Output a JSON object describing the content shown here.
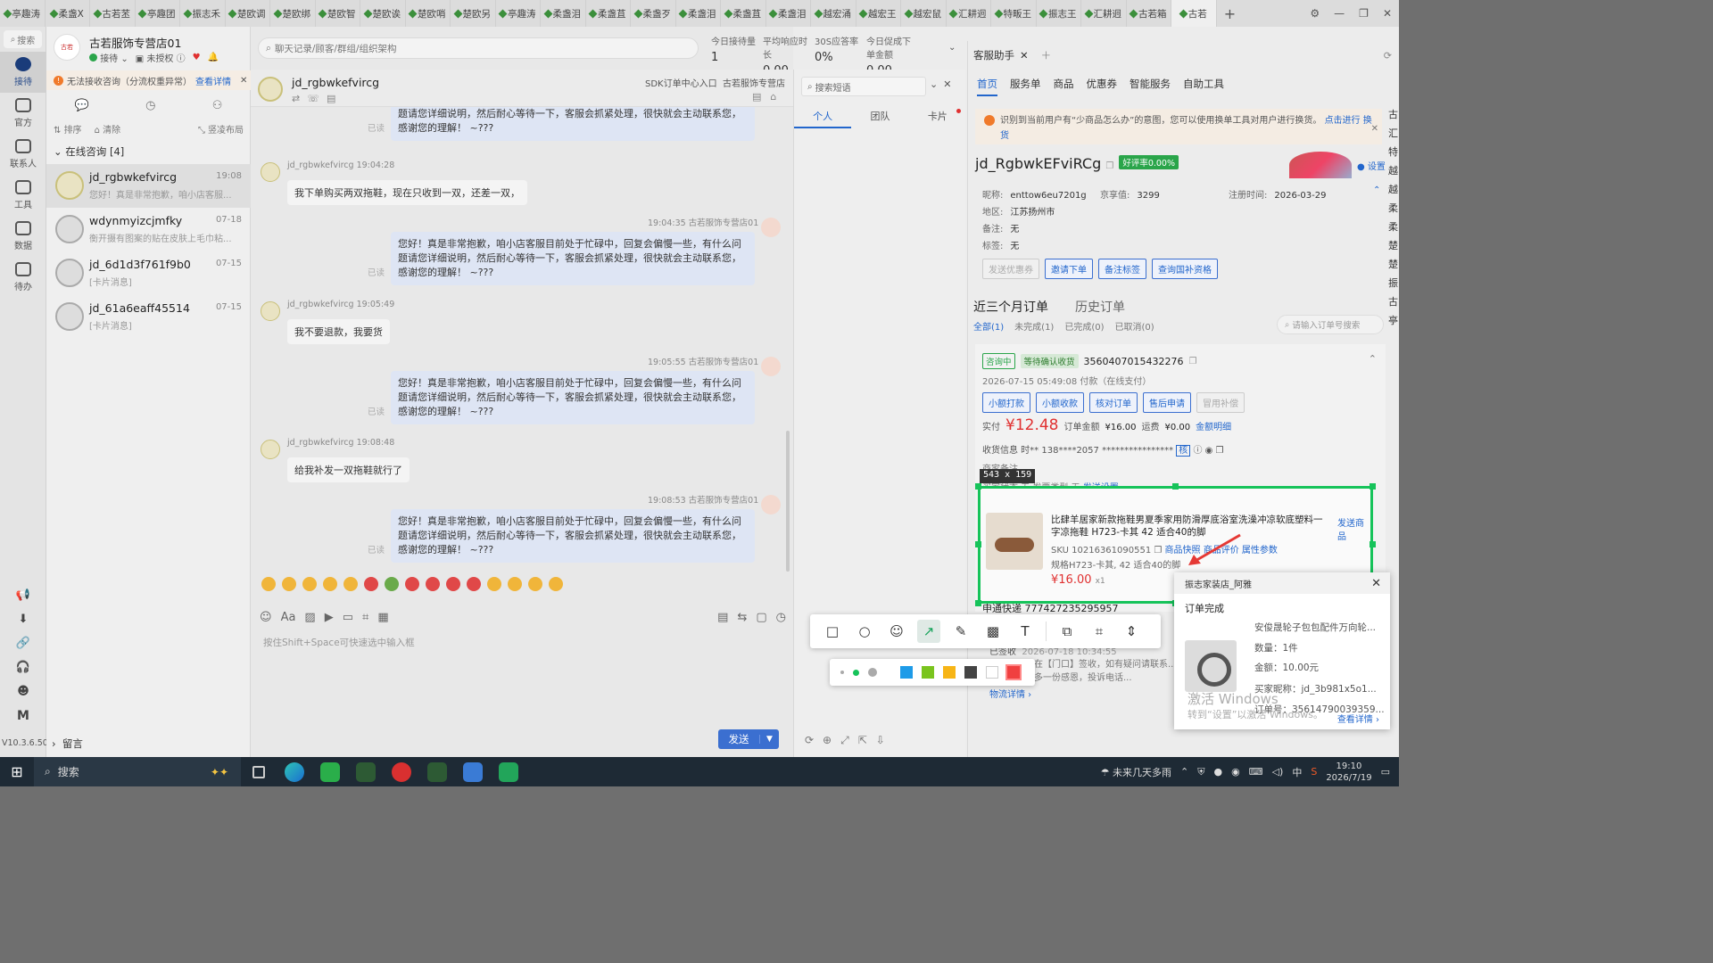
{
  "tabs": [
    {
      "label": "亭趣涛"
    },
    {
      "label": "柔盏X"
    },
    {
      "label": "古若苤"
    },
    {
      "label": "亭趣团"
    },
    {
      "label": "振志禾"
    },
    {
      "label": "楚欧调"
    },
    {
      "label": "楚欧绑"
    },
    {
      "label": "楚欧智"
    },
    {
      "label": "楚欧诶"
    },
    {
      "label": "楚欧哨"
    },
    {
      "label": "楚欧另"
    },
    {
      "label": "亭趣涛"
    },
    {
      "label": "柔盏泪"
    },
    {
      "label": "柔盏苴"
    },
    {
      "label": "柔盏歹"
    },
    {
      "label": "柔盏泪"
    },
    {
      "label": "柔盏苴"
    },
    {
      "label": "柔盏泪"
    },
    {
      "label": "越宏涌"
    },
    {
      "label": "越宏王"
    },
    {
      "label": "越宏鼠"
    },
    {
      "label": "汇耕迥"
    },
    {
      "label": "特畈王"
    },
    {
      "label": "振志王"
    },
    {
      "label": "汇耕迥"
    },
    {
      "label": "古若箱"
    },
    {
      "label": "古若"
    }
  ],
  "nav": {
    "search": "搜索",
    "items": [
      {
        "label": "接待"
      },
      {
        "label": "官方"
      },
      {
        "label": "联系人"
      },
      {
        "label": "工具"
      },
      {
        "label": "数据"
      },
      {
        "label": "待办"
      }
    ],
    "version": "V10.3.6.500",
    "m_label": "M"
  },
  "sessions_pane": {
    "shop_name": "古若服饰专营店01",
    "status_receiving": "接待",
    "status_unauth": "未授权",
    "warning": "无法接收咨询（分流权重异常）",
    "warning_link": "查看详情",
    "tools": {
      "sort": "排序",
      "clear": "清除",
      "layout": "竖凌布局"
    },
    "online_header": "在线咨询 [4]",
    "items": [
      {
        "name": "jd_rgbwkefvircg",
        "time": "19:08",
        "msg": "您好！真是非常抱歉，咱小店客服..."
      },
      {
        "name": "wdynmyizcjmfky",
        "time": "07-18",
        "msg": "衡开摄有图案的贴在皮肤上毛巾粘..."
      },
      {
        "name": "jd_6d1d3f761f9b0",
        "time": "07-15",
        "msg": "[卡片消息]"
      },
      {
        "name": "jd_61a6eaff45514",
        "time": "07-15",
        "msg": "[卡片消息]"
      }
    ],
    "liuyan": "留言"
  },
  "chat": {
    "search_placeholder": "聊天记录/顾客/群组/组织架构",
    "stats": [
      {
        "label": "今日接待量",
        "value": "1"
      },
      {
        "label": "平均响应时长",
        "value": "0.00"
      },
      {
        "label": "30S应答率",
        "value": "0%"
      },
      {
        "label": "今日促成下单金额",
        "value": "0.00"
      }
    ],
    "contact": "jd_rgbwkefvircg",
    "sdk_entry": "SDK订单中心入口",
    "shop_short": "古若服饰专营店",
    "reply_text": "您好！真是非常抱歉，咱小店客服目前处于忙碌中，回复会偏慢一些，有什么问题请您详细说明，然后耐心等待一下，客服会抓紧处理，很快就会主动联系您，感谢您的理解！ ~???",
    "read": "已读",
    "messages": [
      {
        "meta": "jd_rgbwkefvircg 19:04:28",
        "text": "我下单购买两双拖鞋，现在只收到一双，还差一双，"
      },
      {
        "meta": "19:04:35  古若服饰专营店01"
      },
      {
        "meta": "jd_rgbwkefvircg 19:05:49",
        "text": "我不要退款，我要货"
      },
      {
        "meta": "19:05:55  古若服饰专营店01"
      },
      {
        "meta": "jd_rgbwkefvircg 19:08:48",
        "text": "给我补发一双拖鞋就行了"
      },
      {
        "meta": "19:08:53  古若服饰专营店01"
      }
    ],
    "input_hint": "按住Shift+Space可快速选中输入框",
    "send": "发送"
  },
  "quick_reply": {
    "search_placeholder": "搜索短语",
    "tabs": [
      {
        "label": "个人"
      },
      {
        "label": "团队"
      },
      {
        "label": "卡片"
      }
    ]
  },
  "assistant": {
    "tab": "客服助手",
    "nav": [
      {
        "label": "首页"
      },
      {
        "label": "服务单"
      },
      {
        "label": "商品"
      },
      {
        "label": "优惠券"
      },
      {
        "label": "智能服务"
      },
      {
        "label": "自助工具"
      }
    ],
    "warning": "识别到当前用户有“少商品怎么办”的意图，您可以使用换单工具对用户进行换货。",
    "warning_link": "点击进行",
    "warning_link2": "换货",
    "customer_id": "jd_RgbwkEFviRCg",
    "rating": "好评率0.00%",
    "settings": "设置",
    "nickname_label": "昵称:",
    "nickname": "enttow6eu7201g",
    "jingxiang_label": "京享值:",
    "jingxiang": "3299",
    "register_label": "注册时间:",
    "register": "2026-03-29",
    "region_label": "地区:",
    "region": "江苏扬州市",
    "remark_label": "备注:",
    "remark": "无",
    "tag_label": "标签:",
    "tag": "无",
    "buttons": [
      {
        "label": "发送优惠券"
      },
      {
        "label": "邀请下单"
      },
      {
        "label": "备注标签"
      },
      {
        "label": "查询国补资格"
      }
    ],
    "orders_tab": "近三个月订单",
    "history_tab": "历史订单",
    "order_filters": [
      {
        "label": "全部(1)"
      },
      {
        "label": "未完成(1)"
      },
      {
        "label": "已完成(0)"
      },
      {
        "label": "已取消(0)"
      }
    ],
    "order_search": "请输入订单号搜索",
    "order": {
      "consult_tag": "咨询中",
      "status_tag": "等待确认收货",
      "id": "3560407015432276",
      "time": "2026-07-15 05:49:08  付款（在线支付）",
      "actions": [
        {
          "label": "小额打款"
        },
        {
          "label": "小额收款"
        },
        {
          "label": "核对订单"
        },
        {
          "label": "售后申请"
        },
        {
          "label": "冒用补偿"
        }
      ],
      "paid_label": "实付",
      "paid": "¥12.48",
      "amount_label": "订单金额",
      "amount": "¥16.00",
      "freight_label": "运费",
      "freight": "¥0.00",
      "detail_link": "金额明细",
      "receiver": "收货信息  时**   138****2057   ****************",
      "receiver_tag": "核",
      "merchant_remark": "商家备注",
      "fields": "买家状态  无    发票类型  无",
      "fields_link": "发送设置",
      "express": "申通快递 777427235295957",
      "arrived": "已签收",
      "arrived_time": "2026-07-18 10:34:55",
      "logistics": "您的快件已在【门口】签收，如有疑问请联系...一次投递，多一份感恩，投诉电话...",
      "logistics_link": "物流详情"
    },
    "product": {
      "title": "比肆羊居家新款拖鞋男夏季家用防滑厚底浴室洗澡冲凉软底塑料一字凉拖鞋 H723-卡其 42 适合40的脚",
      "sku": "SKU 10216361090551",
      "link1": "商品快照",
      "link2": "商品评价",
      "link3": "属性参数",
      "spec": "规格H723-卡其, 42 适合40的脚",
      "price": "¥16.00",
      "qty": "x1",
      "send": "发送商品"
    }
  },
  "screenshot_tool": {
    "dims": "543 x 159"
  },
  "toast": {
    "title": "振志家装店_阿雅",
    "status": "订单完成",
    "product": "安俊晟轮子包包配件万向轮...",
    "qty": "数量：1件",
    "amount": "金额：10.00元",
    "buyer": "买家昵称：jd_3b981x5o1...",
    "order": "订单号：35614790039359...",
    "link": "查看详情"
  },
  "watermark": {
    "line1": "激活 Windows",
    "line2": "转到“设置”以激活 Windows。"
  },
  "edge_text": "古汇特越越柔柔楚楚振古亭",
  "taskbar": {
    "search": "搜索",
    "weather": "未来几天多雨",
    "ime": "中",
    "time": "19:10",
    "date": "2026/7/19"
  },
  "colors": {
    "accent": "#2266cc",
    "success": "#16c35a",
    "price": "#e03030",
    "warning": "#f07a2a"
  }
}
